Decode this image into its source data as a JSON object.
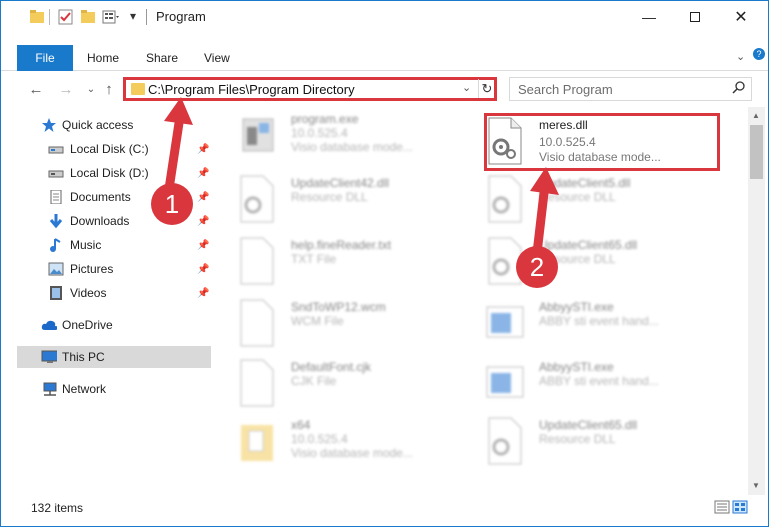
{
  "window": {
    "title": "Program"
  },
  "ribbon": {
    "file": "File",
    "home": "Home",
    "share": "Share",
    "view": "View"
  },
  "address": {
    "path": "C:\\Program Files\\Program Directory"
  },
  "search": {
    "placeholder": "Search Program"
  },
  "sidebar": {
    "items": [
      {
        "label": "Quick access",
        "icon": "star-icon"
      },
      {
        "label": "Local Disk (C:)",
        "icon": "drive-icon"
      },
      {
        "label": "Local Disk (D:)",
        "icon": "drive-icon"
      },
      {
        "label": "Documents",
        "icon": "documents-icon"
      },
      {
        "label": "Downloads",
        "icon": "download-icon"
      },
      {
        "label": "Music",
        "icon": "music-icon"
      },
      {
        "label": "Pictures",
        "icon": "pictures-icon"
      },
      {
        "label": "Videos",
        "icon": "videos-icon"
      },
      {
        "label": "OneDrive",
        "icon": "cloud-icon"
      },
      {
        "label": "This PC",
        "icon": "computer-icon"
      },
      {
        "label": "Network",
        "icon": "network-icon"
      }
    ]
  },
  "files": [
    {
      "name": "program.exe",
      "sub1": "10.0.525.4",
      "sub2": "Visio database mode..."
    },
    {
      "name": "meres.dll",
      "sub1": "10.0.525.4",
      "sub2": "Visio database mode..."
    },
    {
      "name": "UpdateClient42.dll",
      "sub1": "Resource DLL"
    },
    {
      "name": "UpdateClient5.dll",
      "sub1": "Resource DLL"
    },
    {
      "name": "help.fineReader.txt",
      "sub1": "TXT File"
    },
    {
      "name": "UpdateClient65.dll",
      "sub1": "Resource DLL"
    },
    {
      "name": "SndToWP12.wcm",
      "sub1": "WCM File"
    },
    {
      "name": "AbbyySTI.exe",
      "sub1": "ABBY sti event hand..."
    },
    {
      "name": "DefaultFont.cjk",
      "sub1": "CJK File"
    },
    {
      "name": "AbbyySTI.exe",
      "sub1": "ABBY sti event hand..."
    },
    {
      "name": "x64",
      "sub1": "10.0.525.4",
      "sub2": "Visio database mode..."
    },
    {
      "name": "UpdateClient65.dll",
      "sub1": "Resource DLL"
    }
  ],
  "status": {
    "items": "132 items"
  },
  "annotations": {
    "badge1": "1",
    "badge2": "2"
  },
  "colors": {
    "accent": "#1979ca",
    "highlight": "#d9363e"
  }
}
